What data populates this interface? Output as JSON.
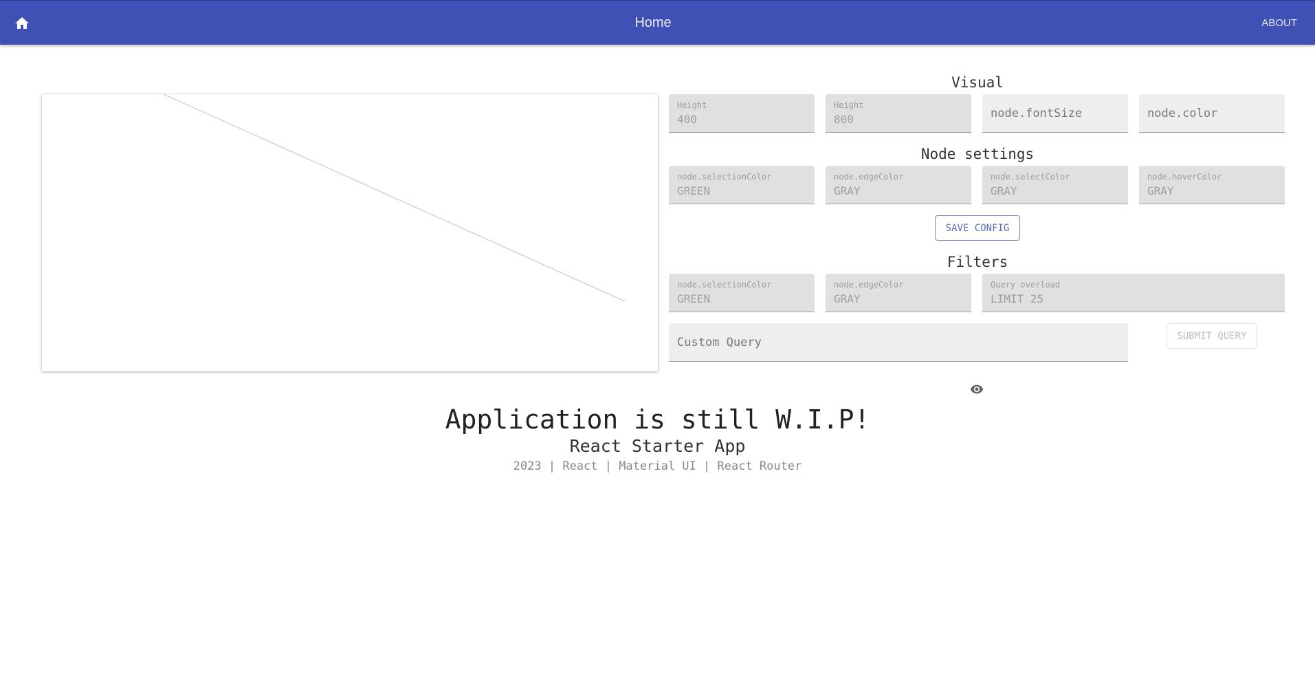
{
  "appbar": {
    "title": "Home",
    "about_label": "ABOUT",
    "home_icon": "home-icon",
    "color": "#3f51b5"
  },
  "visual": {
    "title": "Visual",
    "fields": [
      {
        "label": "Height",
        "value": "400"
      },
      {
        "label": "Height",
        "value": "800"
      },
      {
        "placeholder": "node.fontSize"
      },
      {
        "placeholder": "node.color"
      }
    ]
  },
  "node_settings": {
    "title": "Node settings",
    "fields": [
      {
        "label": "node.selectionColor",
        "value": "GREEN"
      },
      {
        "label": "node.edgeColor",
        "value": "GRAY"
      },
      {
        "label": "node.selectColor",
        "value": "GRAY"
      },
      {
        "label": "node.hoverColor",
        "value": "GRAY"
      }
    ],
    "save_label": "SAVE CONFIG"
  },
  "filters": {
    "title": "Filters",
    "fields": [
      {
        "label": "node.selectionColor",
        "value": "GREEN"
      },
      {
        "label": "node.edgeColor",
        "value": "GRAY"
      },
      {
        "label": "Query overload",
        "value": "LIMIT 25"
      }
    ],
    "custom_query_placeholder": "Custom Query",
    "submit_label": "SUBMIT QUERY",
    "visibility_icon": "eye-icon"
  },
  "footer": {
    "heading": "Application is still W.I.P!",
    "subtitle": "React Starter App",
    "credits": "2023 | React | Material UI | React Router"
  }
}
